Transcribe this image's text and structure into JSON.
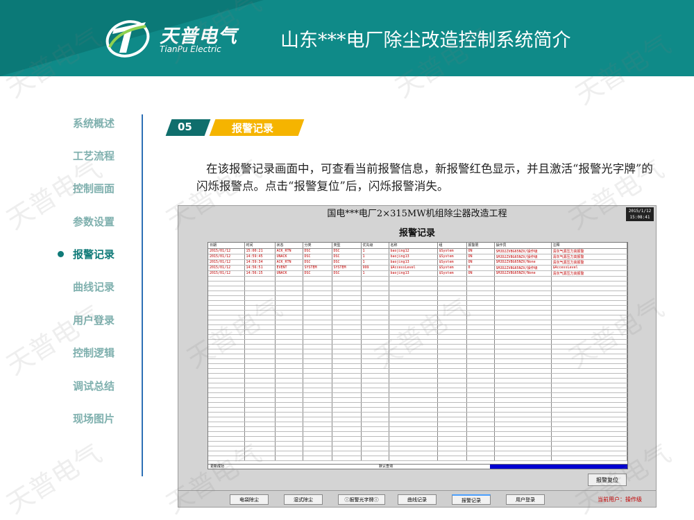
{
  "header": {
    "logo_cn": "天普电气",
    "logo_en": "TianPu Electric",
    "title": "山东***电厂除尘改造控制系统简介"
  },
  "sidebar": {
    "items": [
      {
        "label": "系统概述"
      },
      {
        "label": "工艺流程"
      },
      {
        "label": "控制画面"
      },
      {
        "label": "参数设置"
      },
      {
        "label": "报警记录"
      },
      {
        "label": "曲线记录"
      },
      {
        "label": "用户登录"
      },
      {
        "label": "控制逻辑"
      },
      {
        "label": "调试总结"
      },
      {
        "label": "现场图片"
      }
    ],
    "active_index": 4
  },
  "section": {
    "number": "05",
    "title": "报警记录"
  },
  "description": "在该报警记录画面中，可查看当前报警信息，新报警红色显示，并且激活“报警光字牌”的闪烁报警点。点击“报警复位”后，闪烁报警消失。",
  "app": {
    "title": "国电***电厂2×315MW机组除尘器改造工程",
    "clock_date": "2015/1/12",
    "clock_time": "15:08:41",
    "subtitle": "报警记录",
    "columns": [
      "日期",
      "时间",
      "状态",
      "分类",
      "类型",
      "优先级",
      "名称",
      "组",
      "报警限",
      "操作员",
      "注释"
    ],
    "rows": [
      [
        "2015/01/12",
        "15:00:21",
        "ACK_RTN",
        "DSC",
        "DSC",
        "1",
        "baojing12",
        "$System",
        "ON",
        "SMJD2ZVBG65NZV/操作级",
        "清灰气源压力高报警"
      ],
      [
        "2015/01/12",
        "14:59:45",
        "UNACK",
        "DSC",
        "DSC",
        "1",
        "baojing13",
        "$System",
        "ON",
        "SMJD2ZVBG65NZV/操作级",
        "清灰气源压力高报警"
      ],
      [
        "2015/01/12",
        "14:59:34",
        "ACK_RTN",
        "DSC",
        "DSC",
        "1",
        "baojing13",
        "$System",
        "ON",
        "SMJD2ZVBG65NZV/None",
        "清灰气源压力高报警"
      ],
      [
        "2015/01/12",
        "14:56:51",
        "EVENT",
        "SYSTEM",
        "SYSTEM",
        "999",
        "$AccessLevel",
        "$System",
        "0",
        "SMJD2ZVBG65NZV/操作级",
        "$AccessLevel"
      ],
      [
        "2015/01/12",
        "14:56:15",
        "UNACK",
        "DSC",
        "DSC",
        "1",
        "baojing13",
        "$System",
        "ON",
        "SMJD2ZVBG65NZV/None",
        "清灰气源压力高报警"
      ]
    ],
    "status_left": "更新成功",
    "status_mid": "默认查询",
    "reset_button": "报警复位",
    "nav_buttons": [
      "电袋除尘",
      "湿式除尘",
      "报警光字牌",
      "曲线记录",
      "报警记录",
      "用户登录"
    ],
    "nav_selected_index": 4,
    "user_prefix": "当前用户：",
    "user_value": "操作级"
  },
  "watermark": "天普电气",
  "colors": {
    "header_teal": "#0f8a88",
    "accent_orange": "#f5b400",
    "section_dark": "#0f6e6c",
    "alarm_red": "#c00000",
    "divider_blue": "#2c6fb5"
  }
}
